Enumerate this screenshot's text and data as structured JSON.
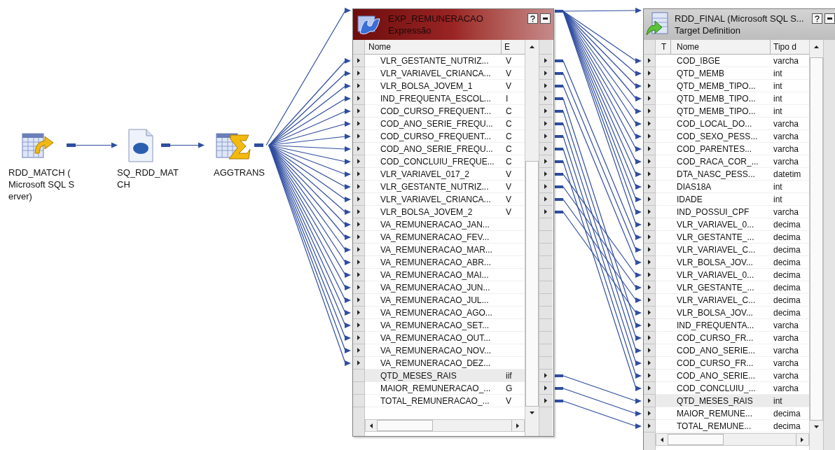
{
  "nodes": [
    {
      "kind": "source",
      "label": "RDD_MATCH (\nMicrosoft SQL S\nerver)"
    },
    {
      "kind": "source_qualifier",
      "label": "SQ_RDD_MAT\nCH"
    },
    {
      "kind": "aggregator",
      "label": "AGGTRANS"
    }
  ],
  "expression": {
    "title": "EXP_REMUNERACAO",
    "subtitle": "Expressão",
    "columns": [
      "Nome",
      "E"
    ],
    "rows": [
      {
        "name": "VLR_GESTANTE_NUTRIZ...",
        "value": "V",
        "in": true,
        "out": true,
        "selected": false
      },
      {
        "name": "VLR_VARIAVEL_CRIANCA...",
        "value": "V",
        "in": true,
        "out": true,
        "selected": false
      },
      {
        "name": "VLR_BOLSA_JOVEM_1",
        "value": "V",
        "in": true,
        "out": true,
        "selected": false
      },
      {
        "name": "IND_FREQUENTA_ESCOL...",
        "value": "I",
        "in": true,
        "out": true,
        "selected": false
      },
      {
        "name": "COD_CURSO_FREQUENT...",
        "value": "C",
        "in": true,
        "out": true,
        "selected": false
      },
      {
        "name": "COD_ANO_SERIE_FREQU...",
        "value": "C",
        "in": true,
        "out": true,
        "selected": false
      },
      {
        "name": "COD_CURSO_FREQUENT...",
        "value": "C",
        "in": true,
        "out": true,
        "selected": false
      },
      {
        "name": "COD_ANO_SERIE_FREQU...",
        "value": "C",
        "in": true,
        "out": true,
        "selected": false
      },
      {
        "name": "COD_CONCLUIU_FREQUE...",
        "value": "C",
        "in": true,
        "out": true,
        "selected": false
      },
      {
        "name": "VLR_VARIAVEL_017_2",
        "value": "V",
        "in": true,
        "out": true,
        "selected": false
      },
      {
        "name": "VLR_GESTANTE_NUTRIZ...",
        "value": "V",
        "in": true,
        "out": true,
        "selected": false
      },
      {
        "name": "VLR_VARIAVEL_CRIANCA...",
        "value": "V",
        "in": true,
        "out": true,
        "selected": false
      },
      {
        "name": "VLR_BOLSA_JOVEM_2",
        "value": "V",
        "in": true,
        "out": true,
        "selected": false
      },
      {
        "name": "VA_REMUNERACAO_JAN...",
        "value": "",
        "in": true,
        "out": false,
        "selected": false
      },
      {
        "name": "VA_REMUNERACAO_FEV...",
        "value": "",
        "in": true,
        "out": false,
        "selected": false
      },
      {
        "name": "VA_REMUNERACAO_MAR...",
        "value": "",
        "in": true,
        "out": false,
        "selected": false
      },
      {
        "name": "VA_REMUNERACAO_ABR...",
        "value": "",
        "in": true,
        "out": false,
        "selected": false
      },
      {
        "name": "VA_REMUNERACAO_MAI...",
        "value": "",
        "in": true,
        "out": false,
        "selected": false
      },
      {
        "name": "VA_REMUNERACAO_JUN...",
        "value": "",
        "in": true,
        "out": false,
        "selected": false
      },
      {
        "name": "VA_REMUNERACAO_JUL...",
        "value": "",
        "in": true,
        "out": false,
        "selected": false
      },
      {
        "name": "VA_REMUNERACAO_AGO...",
        "value": "",
        "in": true,
        "out": false,
        "selected": false
      },
      {
        "name": "VA_REMUNERACAO_SET...",
        "value": "",
        "in": true,
        "out": false,
        "selected": false
      },
      {
        "name": "VA_REMUNERACAO_OUT...",
        "value": "",
        "in": true,
        "out": false,
        "selected": false
      },
      {
        "name": "VA_REMUNERACAO_NOV...",
        "value": "",
        "in": true,
        "out": false,
        "selected": false
      },
      {
        "name": "VA_REMUNERACAO_DEZ...",
        "value": "",
        "in": true,
        "out": false,
        "selected": false
      },
      {
        "name": "QTD_MESES_RAIS",
        "value": "iif",
        "in": false,
        "out": true,
        "selected": true
      },
      {
        "name": "MAIOR_REMUNERACAO_...",
        "value": "G",
        "in": false,
        "out": true,
        "selected": false
      },
      {
        "name": "TOTAL_REMUNERACAO_...",
        "value": "V",
        "in": false,
        "out": true,
        "selected": false
      }
    ]
  },
  "target": {
    "title": "RDD_FINAL (Microsoft SQL S...",
    "subtitle": "Target Definition",
    "columns": [
      "T",
      "Nome",
      "Tipo d"
    ],
    "rows": [
      {
        "name": "COD_IBGE",
        "type": "varcha",
        "selected": false
      },
      {
        "name": "QTD_MEMB",
        "type": "int",
        "selected": false
      },
      {
        "name": "QTD_MEMB_TIPO...",
        "type": "int",
        "selected": false
      },
      {
        "name": "QTD_MEMB_TIPO...",
        "type": "int",
        "selected": false
      },
      {
        "name": "QTD_MEMB_TIPO...",
        "type": "int",
        "selected": false
      },
      {
        "name": "COD_LOCAL_DO...",
        "type": "varcha",
        "selected": false
      },
      {
        "name": "COD_SEXO_PESS...",
        "type": "varcha",
        "selected": false
      },
      {
        "name": "COD_PARENTES...",
        "type": "varcha",
        "selected": false
      },
      {
        "name": "COD_RACA_COR_...",
        "type": "varcha",
        "selected": false
      },
      {
        "name": "DTA_NASC_PESS...",
        "type": "datetim",
        "selected": false
      },
      {
        "name": "DIAS18A",
        "type": "int",
        "selected": false
      },
      {
        "name": "IDADE",
        "type": "int",
        "selected": false
      },
      {
        "name": "IND_POSSUI_CPF",
        "type": "varcha",
        "selected": false
      },
      {
        "name": "VLR_VARIAVEL_0...",
        "type": "decima",
        "selected": false
      },
      {
        "name": "VLR_GESTANTE_...",
        "type": "decima",
        "selected": false
      },
      {
        "name": "VLR_VARIAVEL_C...",
        "type": "decima",
        "selected": false
      },
      {
        "name": "VLR_BOLSA_JOV...",
        "type": "decima",
        "selected": false
      },
      {
        "name": "VLR_VARIAVEL_0...",
        "type": "decima",
        "selected": false
      },
      {
        "name": "VLR_GESTANTE_...",
        "type": "decima",
        "selected": false
      },
      {
        "name": "VLR_VARIAVEL_C...",
        "type": "decima",
        "selected": false
      },
      {
        "name": "VLR_BOLSA_JOV...",
        "type": "decima",
        "selected": false
      },
      {
        "name": "IND_FREQUENTA...",
        "type": "varcha",
        "selected": false
      },
      {
        "name": "COD_CURSO_FR...",
        "type": "varcha",
        "selected": false
      },
      {
        "name": "COD_ANO_SERIE...",
        "type": "varcha",
        "selected": false
      },
      {
        "name": "COD_CURSO_FR...",
        "type": "varcha",
        "selected": false
      },
      {
        "name": "COD_ANO_SERIE...",
        "type": "varcha",
        "selected": false
      },
      {
        "name": "COD_CONCLUIU_...",
        "type": "varcha",
        "selected": false
      },
      {
        "name": "QTD_MESES_RAIS",
        "type": "int",
        "selected": true
      },
      {
        "name": "MAIOR_REMUNE...",
        "type": "decima",
        "selected": false
      },
      {
        "name": "TOTAL_REMUNE...",
        "type": "decima",
        "selected": false
      }
    ]
  }
}
